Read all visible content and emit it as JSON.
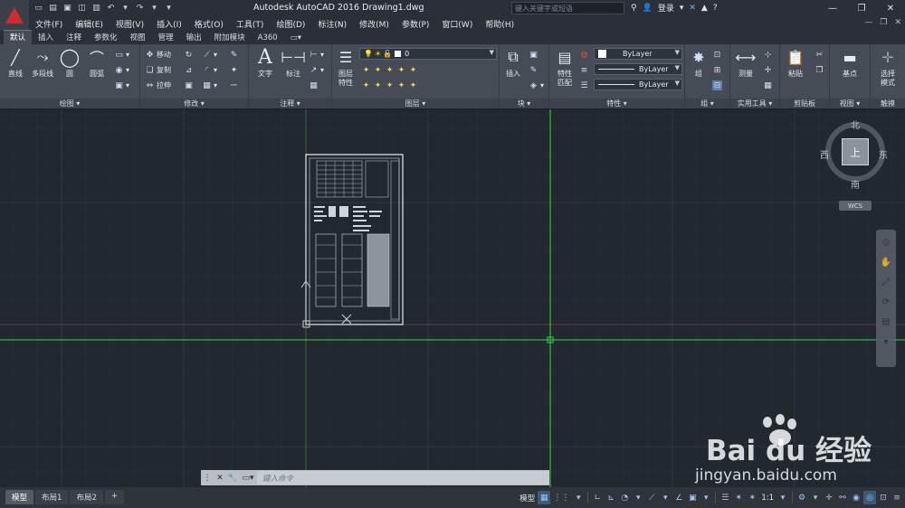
{
  "window": {
    "title": "Autodesk AutoCAD 2016    Drawing1.dwg",
    "search_placeholder": "键入关键字或短语",
    "login_label": "登录",
    "help_label": "?",
    "controls": [
      "—",
      "❐",
      "✕"
    ]
  },
  "menubar": {
    "items": [
      "文件(F)",
      "编辑(E)",
      "视图(V)",
      "插入(I)",
      "格式(O)",
      "工具(T)",
      "绘图(D)",
      "标注(N)",
      "修改(M)",
      "参数(P)",
      "窗口(W)",
      "帮助(H)"
    ]
  },
  "ribbon_tabs": [
    "默认",
    "插入",
    "注释",
    "参数化",
    "视图",
    "管理",
    "输出",
    "附加模块",
    "A360"
  ],
  "ribbon": {
    "draw": {
      "title": "绘图 ▾",
      "line": "直线",
      "polyline": "多段线",
      "circle": "圆",
      "arc": "圆弧"
    },
    "modify": {
      "title": "修改 ▾",
      "move": "移动",
      "copy": "复制",
      "stretch": "拉伸"
    },
    "annotation": {
      "title": "注释 ▾",
      "text": "文字",
      "dimension": "标注"
    },
    "layers": {
      "title": "图层 ▾",
      "layer_props": "图层\n特性",
      "current_layer": "0"
    },
    "block": {
      "title": "块 ▾",
      "insert": "插入"
    },
    "properties": {
      "title": "特性 ▾",
      "match": "特性\n匹配",
      "color": "ByLayer",
      "linetype": "ByLayer",
      "lineweight": "ByLayer"
    },
    "groups": {
      "title": "组 ▾",
      "group": "组"
    },
    "utilities": {
      "title": "实用工具 ▾",
      "measure": "测量"
    },
    "clipboard": {
      "title": "剪贴板",
      "paste": "粘贴"
    },
    "view": {
      "title": "视图 ▾",
      "base": "基点"
    },
    "touch": {
      "title": "触摸",
      "select_mode": "选择\n模式"
    }
  },
  "viewcube": {
    "north": "北",
    "south": "南",
    "east": "东",
    "west": "西",
    "face": "上",
    "wcs": "WCS"
  },
  "commandline": {
    "placeholder": "键入命令"
  },
  "layout_tabs": [
    "模型",
    "布局1",
    "布局2",
    "+"
  ],
  "statusbar": {
    "model_label": "模型",
    "scale": "1:1"
  },
  "watermark": {
    "text": "Bai du 经验",
    "sub": "jingyan.baidu.com"
  },
  "colors": {
    "background": "#212830",
    "crosshair": "#3bd93b",
    "grid": "#2b323b",
    "accent": "#d12b2b"
  }
}
